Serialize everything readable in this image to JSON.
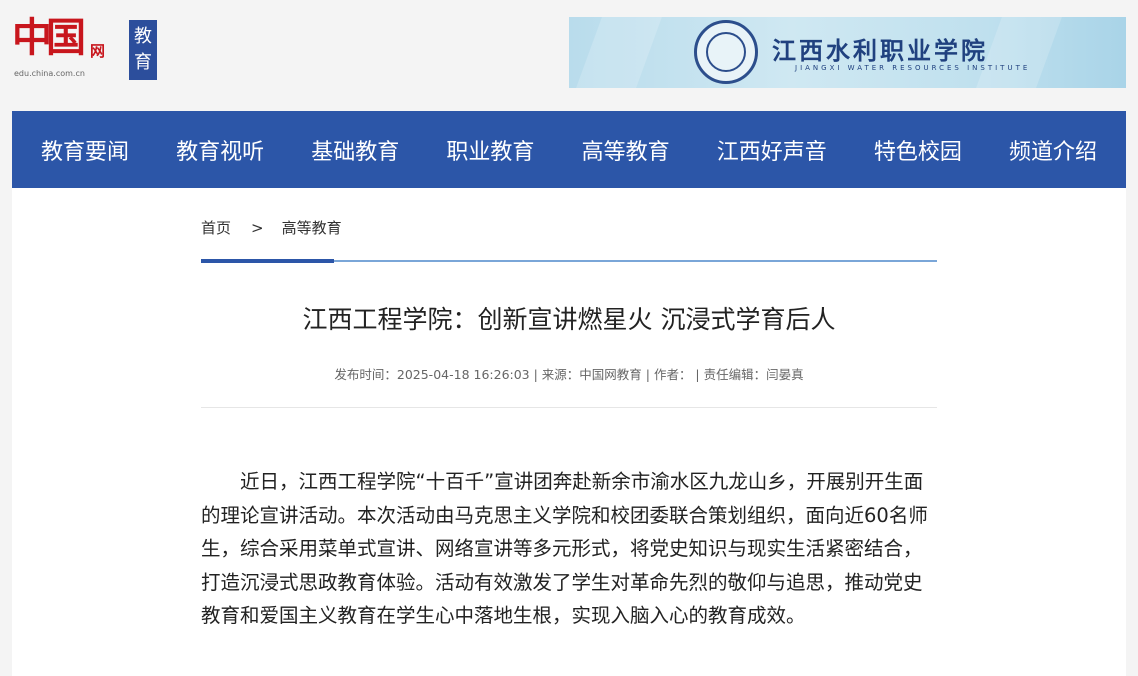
{
  "header": {
    "logo_mark": "中国",
    "logo_suffix": "网",
    "logo_domain": "edu.china.com.cn",
    "channel_line1": "教",
    "channel_line2": "育",
    "banner": {
      "name": "江西水利职业学院",
      "english": "JIANGXI WATER RESOURCES INSTITUTE"
    }
  },
  "nav": {
    "items": [
      "教育要闻",
      "教育视听",
      "基础教育",
      "职业教育",
      "高等教育",
      "江西好声音",
      "特色校园",
      "频道介绍"
    ]
  },
  "breadcrumb": {
    "home": "首页",
    "separator": ">",
    "current": "高等教育"
  },
  "article": {
    "title": "江西工程学院：创新宣讲燃星火 沉浸式学育后人",
    "meta": "发布时间：2025-04-18 16:26:03 | 来源：中国网教育 | 作者：  | 责任编辑：闫晏真",
    "body": "近日，江西工程学院“十百千”宣讲团奔赴新余市渝水区九龙山乡，开展别开生面的理论宣讲活动。本次活动由马克思主义学院和校团委联合策划组织，面向近60名师生，综合采用菜单式宣讲、网络宣讲等多元形式，将党史知识与现实生活紧密结合，打造沉浸式思政教育体验。活动有效激发了学生对革命先烈的敬仰与追思，推动党史教育和爱国主义教育在学生心中落地生根，实现入脑入心的教育成效。"
  },
  "colors": {
    "nav_bg": "#2c56a8",
    "brand_red": "#c8161d",
    "channel_blue": "#2c4e9c"
  }
}
